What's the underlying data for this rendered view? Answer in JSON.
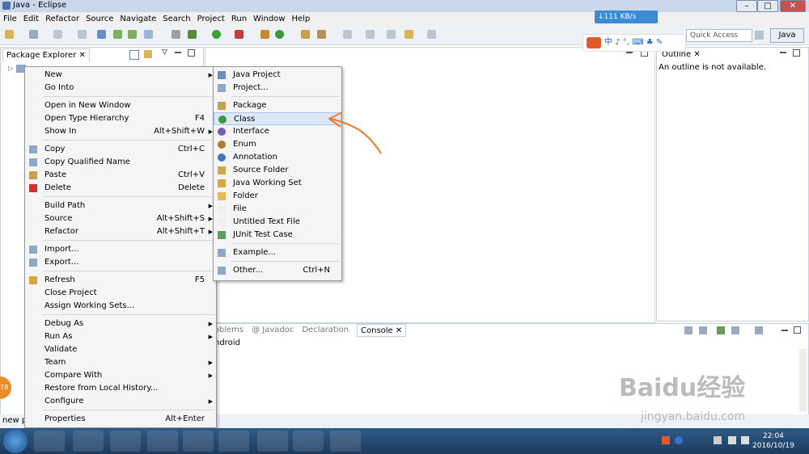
{
  "window": {
    "title": "Java - Eclipse"
  },
  "menubar": [
    "File",
    "Edit",
    "Refactor",
    "Source",
    "Navigate",
    "Search",
    "Project",
    "Run",
    "Window",
    "Help"
  ],
  "toolbar": {
    "quick_access": "Quick Access",
    "perspective": "Java"
  },
  "net_speed": "↓111 KB/s",
  "package_explorer": {
    "tab": "Package Explorer"
  },
  "outline": {
    "tab": "Outline",
    "message": "An outline is not available."
  },
  "bottom": {
    "tabs": [
      "Problems",
      "@ Javadoc",
      "Declaration",
      "Console"
    ],
    "console_text": "ndroid"
  },
  "status": {
    "text": "new p"
  },
  "context_menu": {
    "items": [
      {
        "label": "New",
        "shortcut": "",
        "submenu": true,
        "icon": "none"
      },
      {
        "label": "Go Into",
        "shortcut": "",
        "submenu": false,
        "icon": "none"
      },
      {
        "sep": true
      },
      {
        "label": "Open in New Window",
        "shortcut": "",
        "submenu": false,
        "icon": "none"
      },
      {
        "label": "Open Type Hierarchy",
        "shortcut": "F4",
        "submenu": false,
        "icon": "none"
      },
      {
        "label": "Show In",
        "shortcut": "Alt+Shift+W",
        "submenu": true,
        "icon": "none"
      },
      {
        "sep": true
      },
      {
        "label": "Copy",
        "shortcut": "Ctrl+C",
        "submenu": false,
        "icon": "copy"
      },
      {
        "label": "Copy Qualified Name",
        "shortcut": "",
        "submenu": false,
        "icon": "copy"
      },
      {
        "label": "Paste",
        "shortcut": "Ctrl+V",
        "submenu": false,
        "icon": "paste"
      },
      {
        "label": "Delete",
        "shortcut": "Delete",
        "submenu": false,
        "icon": "delete"
      },
      {
        "sep": true
      },
      {
        "label": "Build Path",
        "shortcut": "",
        "submenu": true,
        "icon": "none"
      },
      {
        "label": "Source",
        "shortcut": "Alt+Shift+S",
        "submenu": true,
        "icon": "none"
      },
      {
        "label": "Refactor",
        "shortcut": "Alt+Shift+T",
        "submenu": true,
        "icon": "none"
      },
      {
        "sep": true
      },
      {
        "label": "Import...",
        "shortcut": "",
        "submenu": false,
        "icon": "import"
      },
      {
        "label": "Export...",
        "shortcut": "",
        "submenu": false,
        "icon": "export"
      },
      {
        "sep": true
      },
      {
        "label": "Refresh",
        "shortcut": "F5",
        "submenu": false,
        "icon": "refresh"
      },
      {
        "label": "Close Project",
        "shortcut": "",
        "submenu": false,
        "icon": "none"
      },
      {
        "label": "Assign Working Sets...",
        "shortcut": "",
        "submenu": false,
        "icon": "none"
      },
      {
        "sep": true
      },
      {
        "label": "Debug As",
        "shortcut": "",
        "submenu": true,
        "icon": "none"
      },
      {
        "label": "Run As",
        "shortcut": "",
        "submenu": true,
        "icon": "none"
      },
      {
        "label": "Validate",
        "shortcut": "",
        "submenu": false,
        "icon": "none"
      },
      {
        "label": "Team",
        "shortcut": "",
        "submenu": true,
        "icon": "none"
      },
      {
        "label": "Compare With",
        "shortcut": "",
        "submenu": true,
        "icon": "none"
      },
      {
        "label": "Restore from Local History...",
        "shortcut": "",
        "submenu": false,
        "icon": "none"
      },
      {
        "label": "Configure",
        "shortcut": "",
        "submenu": true,
        "icon": "none"
      },
      {
        "sep": true
      },
      {
        "label": "Properties",
        "shortcut": "Alt+Enter",
        "submenu": false,
        "icon": "none"
      }
    ]
  },
  "new_submenu": {
    "items": [
      {
        "label": "Java Project",
        "shortcut": "",
        "icon": "java-project",
        "color": "#6a8fc7"
      },
      {
        "label": "Project...",
        "shortcut": "",
        "icon": "project",
        "color": "#8fa8c8"
      },
      {
        "sep": true
      },
      {
        "label": "Package",
        "shortcut": "",
        "icon": "package",
        "color": "#c8a050"
      },
      {
        "label": "Class",
        "shortcut": "",
        "icon": "class",
        "color": "#3c9a3c",
        "highlight": true
      },
      {
        "label": "Interface",
        "shortcut": "",
        "icon": "interface",
        "color": "#7a5bb8"
      },
      {
        "label": "Enum",
        "shortcut": "",
        "icon": "enum",
        "color": "#b57a2a"
      },
      {
        "label": "Annotation",
        "shortcut": "",
        "icon": "annotation",
        "color": "#3c7ab8"
      },
      {
        "label": "Source Folder",
        "shortcut": "",
        "icon": "source-folder",
        "color": "#d8a840"
      },
      {
        "label": "Java Working Set",
        "shortcut": "",
        "icon": "working-set",
        "color": "#d8a840"
      },
      {
        "label": "Folder",
        "shortcut": "",
        "icon": "folder",
        "color": "#e8b848"
      },
      {
        "label": "File",
        "shortcut": "",
        "icon": "file",
        "color": "#f0f0f0"
      },
      {
        "label": "Untitled Text File",
        "shortcut": "",
        "icon": "text-file",
        "color": "#f0f0f0"
      },
      {
        "label": "JUnit Test Case",
        "shortcut": "",
        "icon": "junit",
        "color": "#5aa05a"
      },
      {
        "sep": true
      },
      {
        "label": "Example...",
        "shortcut": "",
        "icon": "example",
        "color": "#8fa8c8"
      },
      {
        "sep": true
      },
      {
        "label": "Other...",
        "shortcut": "Ctrl+N",
        "icon": "other",
        "color": "#8fa8c8"
      }
    ]
  },
  "ime": {
    "label": "中 ♪ °, ⌨ ♣ ✎"
  },
  "taskbar": {
    "time": "22:04",
    "date": "2016/10/19",
    "badge": "78"
  },
  "watermark": {
    "main": "Baidu经验",
    "sub": "jingyan.baidu.com"
  }
}
